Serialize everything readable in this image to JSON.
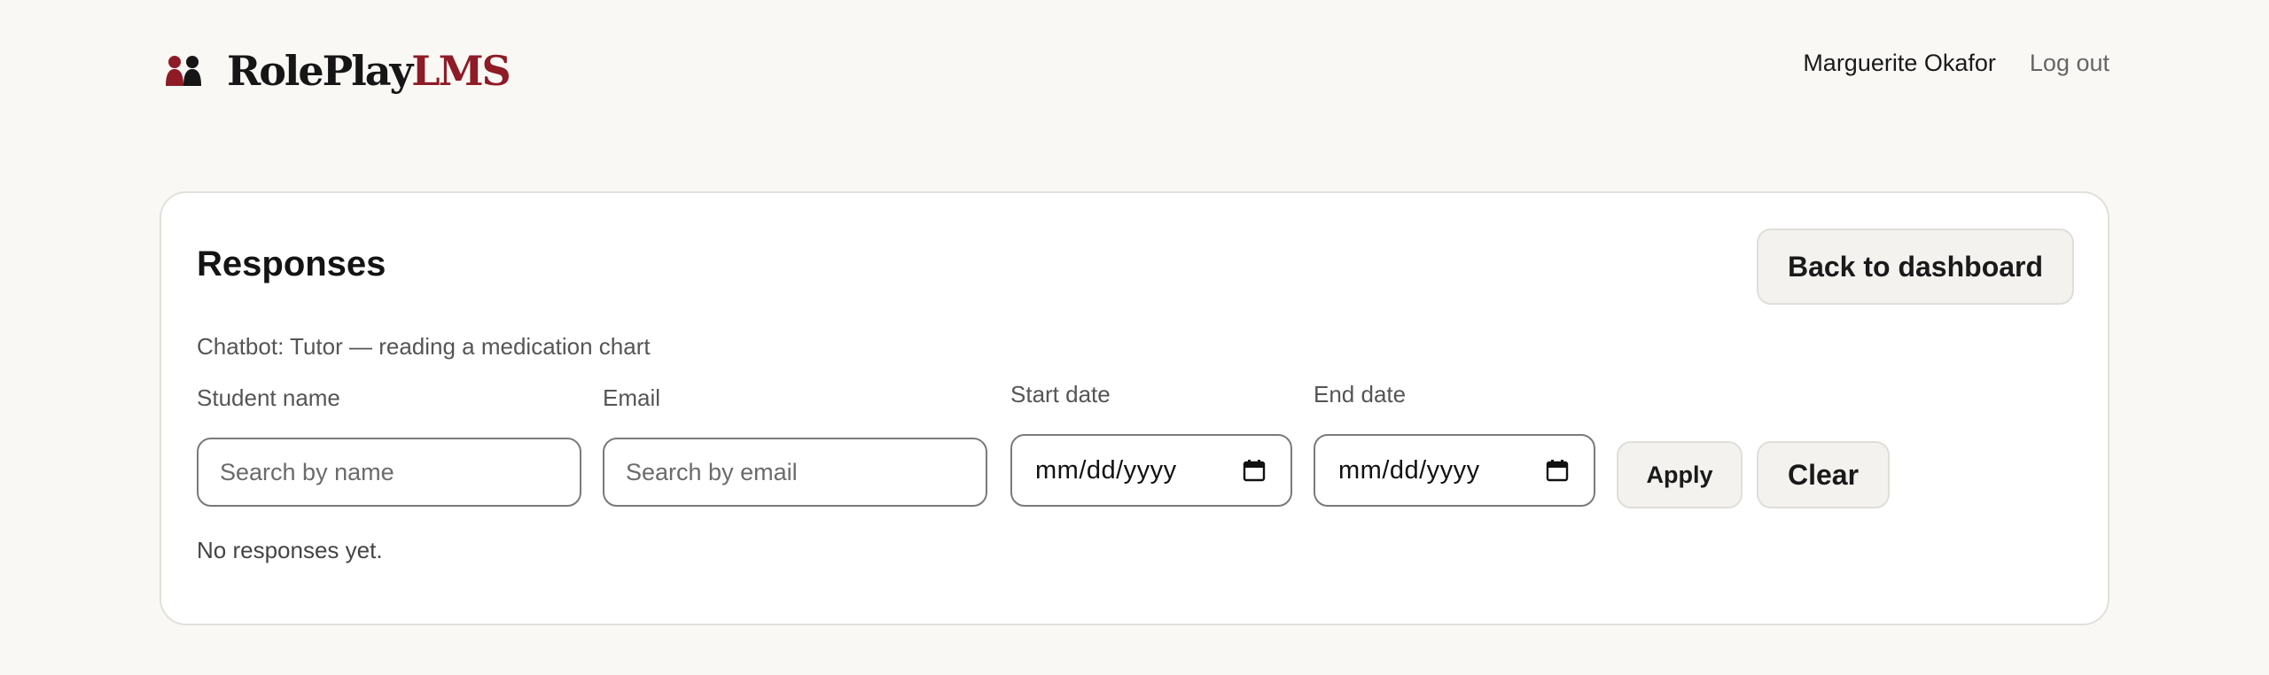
{
  "header": {
    "brand_part1": "RolePlay",
    "brand_part2": "LMS",
    "brand_icon": "two-people-icon",
    "brand_colors": {
      "dark": "#161616",
      "accent": "#8e1b26"
    },
    "user_name": "Marguerite Okafor",
    "logout_label": "Log out"
  },
  "card": {
    "title": "Responses",
    "back_label": "Back to dashboard",
    "subtitle": "Chatbot: Tutor — reading a medication chart",
    "filters": {
      "student_name": {
        "label": "Student name",
        "placeholder": "Search by name",
        "value": ""
      },
      "email": {
        "label": "Email",
        "placeholder": "Search by email",
        "value": ""
      },
      "start_date": {
        "label": "Start date",
        "display": "mm/dd/yyyy"
      },
      "end_date": {
        "label": "End date",
        "display": "mm/dd/yyyy"
      },
      "apply_label": "Apply",
      "clear_label": "Clear"
    },
    "empty_message": "No responses yet."
  }
}
